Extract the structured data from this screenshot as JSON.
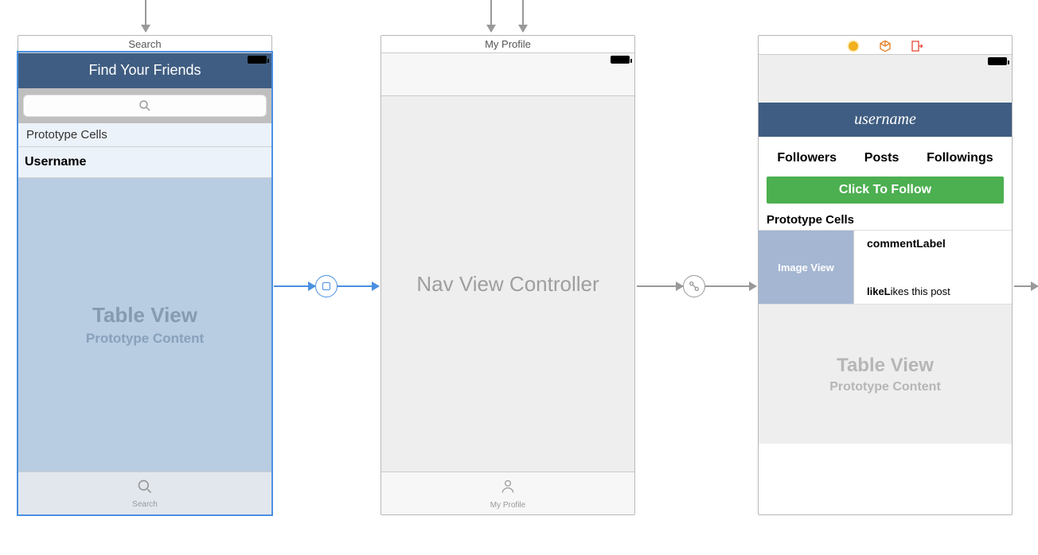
{
  "scene1": {
    "title": "Search",
    "nav_title": "Find Your Friends",
    "prototype_header": "Prototype Cells",
    "cell_label": "Username",
    "tableview_title": "Table View",
    "tableview_sub": "Prototype Content",
    "tab_label": "Search"
  },
  "scene2": {
    "title": "My Profile",
    "body_label": "Nav View Controller",
    "tab_label": "My Profile"
  },
  "scene3": {
    "nav_title": "username",
    "stats": {
      "followers": "Followers",
      "posts": "Posts",
      "followings": "Followings"
    },
    "follow_btn": "Click To Follow",
    "prototype_header": "Prototype Cells",
    "image_view": "Image View",
    "comment_label": "commentLabel",
    "likes_label_1": "likeL",
    "likes_label_2": "ikes this post",
    "tableview_title": "Table View",
    "tableview_sub": "Prototype Content"
  }
}
